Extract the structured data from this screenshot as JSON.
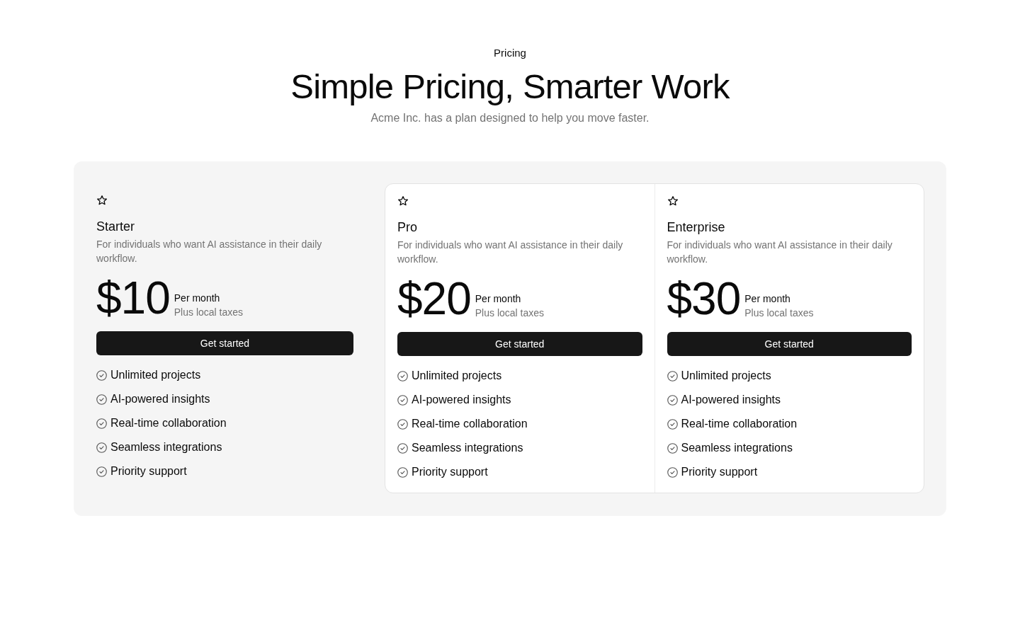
{
  "header": {
    "eyebrow": "Pricing",
    "title": "Simple Pricing, Smarter Work",
    "subtitle": "Acme Inc. has a plan designed to help you move faster."
  },
  "plans": [
    {
      "name": "Starter",
      "highlighted": false,
      "description": "For individuals who want AI assistance in their daily workflow.",
      "price": "$10",
      "period": "Per month",
      "tax_note": "Plus local taxes",
      "button": "Get started",
      "features": [
        "Unlimited projects",
        "AI-powered insights",
        "Real-time collaboration",
        "Seamless integrations",
        "Priority support"
      ]
    },
    {
      "name": "Pro",
      "highlighted": true,
      "description": "For individuals who want AI assistance in their daily workflow.",
      "price": "$20",
      "period": "Per month",
      "tax_note": "Plus local taxes",
      "button": "Get started",
      "features": [
        "Unlimited projects",
        "AI-powered insights",
        "Real-time collaboration",
        "Seamless integrations",
        "Priority support"
      ]
    },
    {
      "name": "Enterprise",
      "highlighted": true,
      "description": "For individuals who want AI assistance in their daily workflow.",
      "price": "$30",
      "period": "Per month",
      "tax_note": "Plus local taxes",
      "button": "Get started",
      "features": [
        "Unlimited projects",
        "AI-powered insights",
        "Real-time collaboration",
        "Seamless integrations",
        "Priority support"
      ]
    }
  ]
}
